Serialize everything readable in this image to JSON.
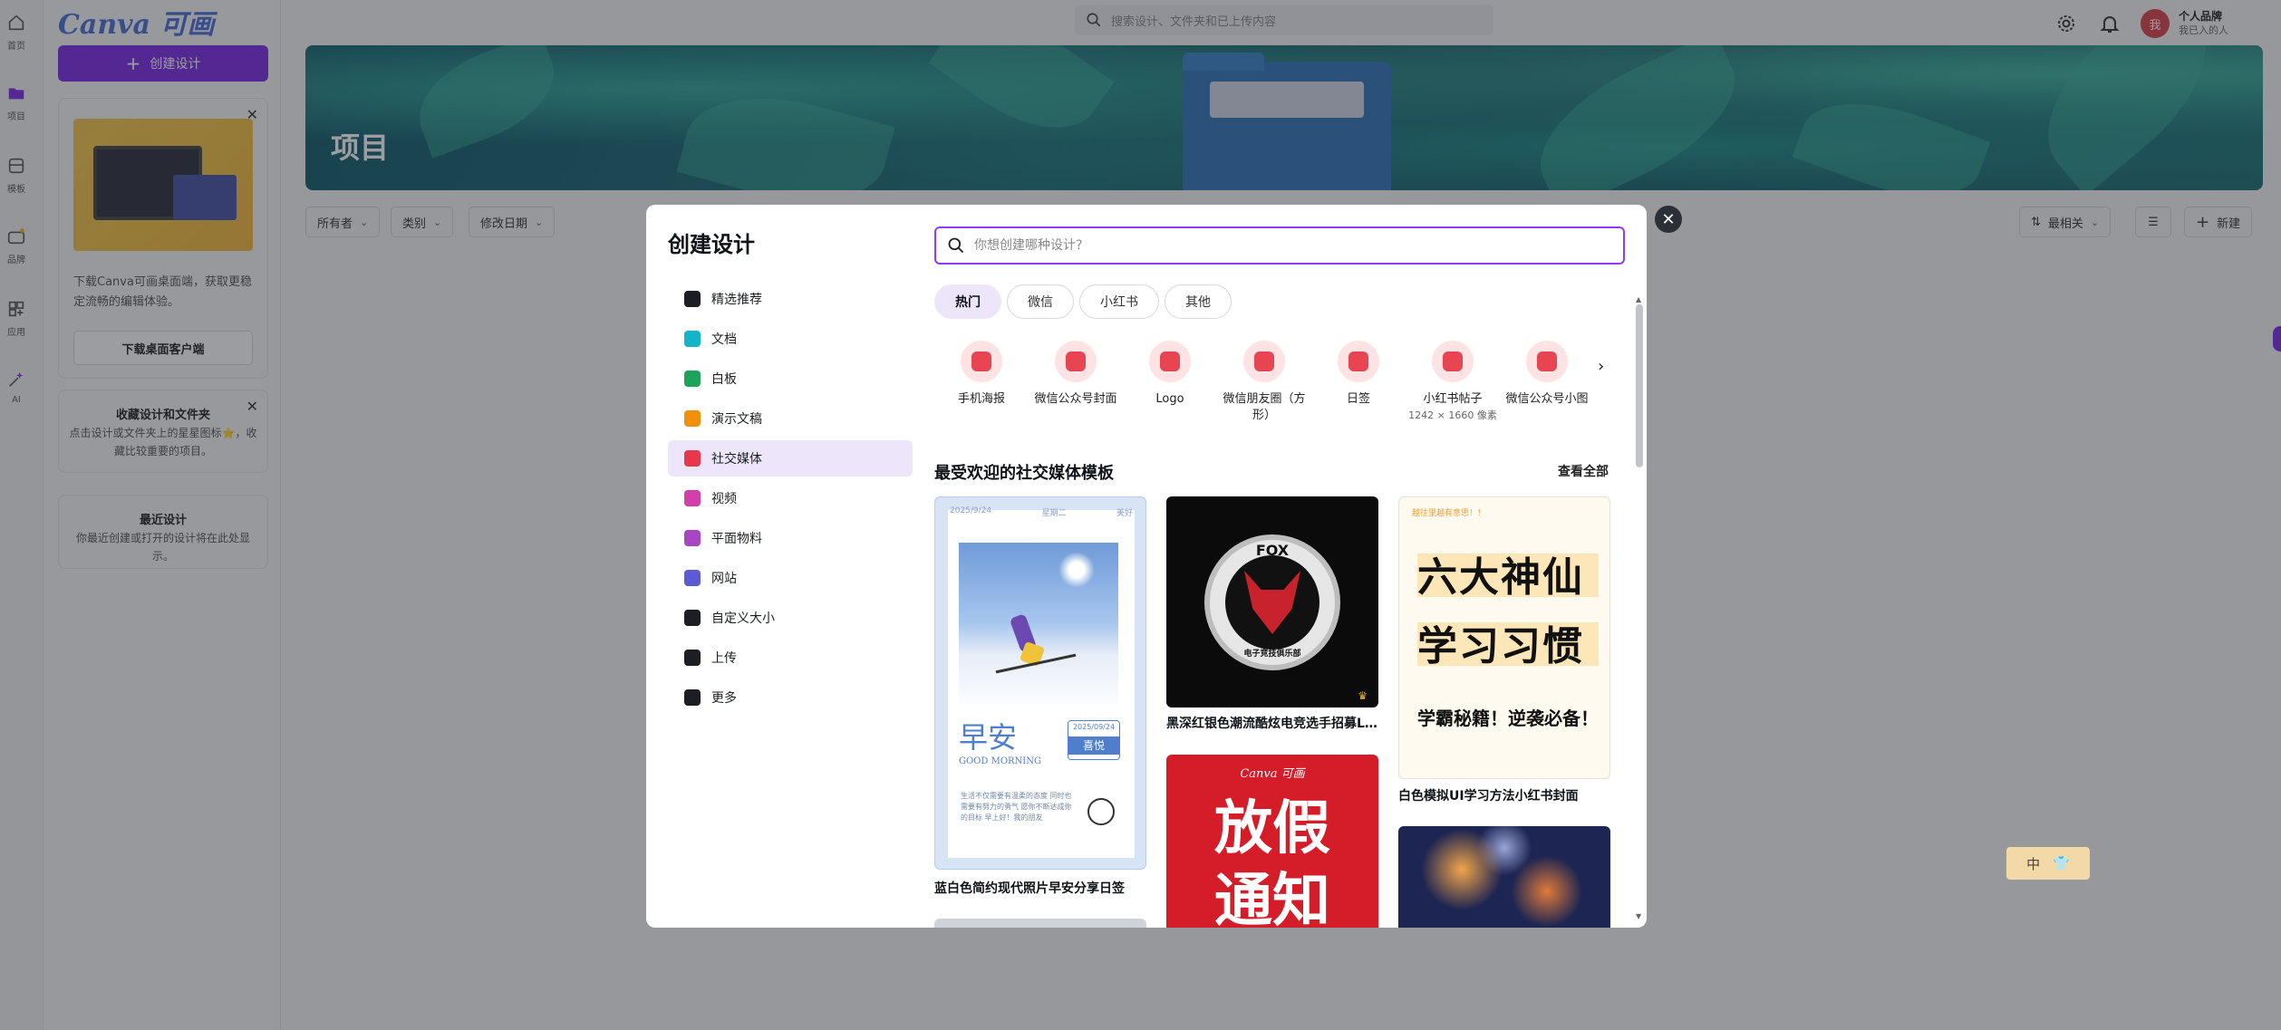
{
  "rail": {
    "items": [
      {
        "label": "首页",
        "icon": "home-icon"
      },
      {
        "label": "项目",
        "icon": "folder-icon"
      },
      {
        "label": "模板",
        "icon": "template-icon"
      },
      {
        "label": "品牌",
        "icon": "brand-icon"
      },
      {
        "label": "应用",
        "icon": "apps-icon"
      },
      {
        "label": "AI",
        "icon": "ai-sparkle-icon"
      }
    ]
  },
  "panel": {
    "logo": "Canva 可画",
    "create_label": "创建设计",
    "promo": {
      "text": "下载Canva可画桌面端，获取更稳定流畅的编辑体验。",
      "button": "下载桌面客户端"
    },
    "favorites": {
      "title": "收藏设计和文件夹",
      "text": "点击设计或文件夹上的星星图标⭐，收藏比较重要的项目。"
    },
    "recent": {
      "title": "最近设计",
      "text": "你最近创建或打开的设计将在此处显示。"
    }
  },
  "topbar": {
    "search_placeholder": "搜索设计、文件夹和已上传内容",
    "avatar": "我",
    "brand_name": "个人品牌",
    "brand_sub": "我已入的人"
  },
  "banner": {
    "title": "项目"
  },
  "filters": {
    "owner": "所有者",
    "category": "类别",
    "modified": "修改日期",
    "sort": "最相关",
    "new": "新建"
  },
  "modal": {
    "title": "创建设计",
    "search_placeholder": "你想创建哪种设计?",
    "nav": [
      {
        "label": "精选推荐",
        "color": "#1b1f24",
        "icon": "sparkle-icon"
      },
      {
        "label": "文档",
        "color": "#13b4c7",
        "icon": "doc-icon"
      },
      {
        "label": "白板",
        "color": "#1fa35b",
        "icon": "whiteboard-icon"
      },
      {
        "label": "演示文稿",
        "color": "#f2900b",
        "icon": "presentation-icon"
      },
      {
        "label": "社交媒体",
        "color": "#e8364b",
        "icon": "social-heart-icon"
      },
      {
        "label": "视频",
        "color": "#d23fa8",
        "icon": "video-icon"
      },
      {
        "label": "平面物料",
        "color": "#a845c2",
        "icon": "print-icon"
      },
      {
        "label": "网站",
        "color": "#5b5bd6",
        "icon": "website-icon"
      },
      {
        "label": "自定义大小",
        "color": "#1b1f24",
        "icon": "custom-size-icon"
      },
      {
        "label": "上传",
        "color": "#1b1f24",
        "icon": "cloud-upload-icon"
      },
      {
        "label": "更多",
        "color": "#1b1f24",
        "icon": "more-icon"
      }
    ],
    "active_nav": 4,
    "chips": [
      "热门",
      "微信",
      "小红书",
      "其他"
    ],
    "types": [
      {
        "label": "手机海报",
        "sub": ""
      },
      {
        "label": "微信公众号封面",
        "sub": ""
      },
      {
        "label": "Logo",
        "sub": ""
      },
      {
        "label": "微信朋友圈（方形）",
        "sub": ""
      },
      {
        "label": "日签",
        "sub": ""
      },
      {
        "label": "小红书帖子",
        "sub": "1242 × 1660 像素"
      },
      {
        "label": "微信公众号小图",
        "sub": ""
      }
    ],
    "section_title": "最受欢迎的社交媒体模板",
    "view_all": "查看全部",
    "templates": [
      {
        "caption": "蓝白色简约现代照片早安分享日签",
        "date": "2025/9/24",
        "weekday": "星期二",
        "tag": "美好",
        "title": "早安",
        "subtitle": "GOOD MORNING",
        "badge_date": "2025/09/24",
        "badge_word": "喜悦",
        "body": "生活不仅需要有温柔的态度 同时也需要有努力的勇气 愿你不断达成你的目标 早上好！我的朋友"
      },
      {
        "caption": "黑深红银色潮流酷炫电竞选手招募Logo",
        "fox_text": "FOX",
        "ring_text": "电子竞技俱乐部"
      },
      {
        "caption": "白色模拟UI学习方法小红书封面",
        "top_text": "越往里越有意思！！",
        "line1": "六大神仙",
        "line2": "学习习惯",
        "line3": "学霸秘籍！逆袭必备！"
      },
      {
        "caption": "",
        "brand": "Canva 可画",
        "line1": "放假",
        "line2": "通知"
      }
    ]
  },
  "ime": {
    "label": "中"
  }
}
